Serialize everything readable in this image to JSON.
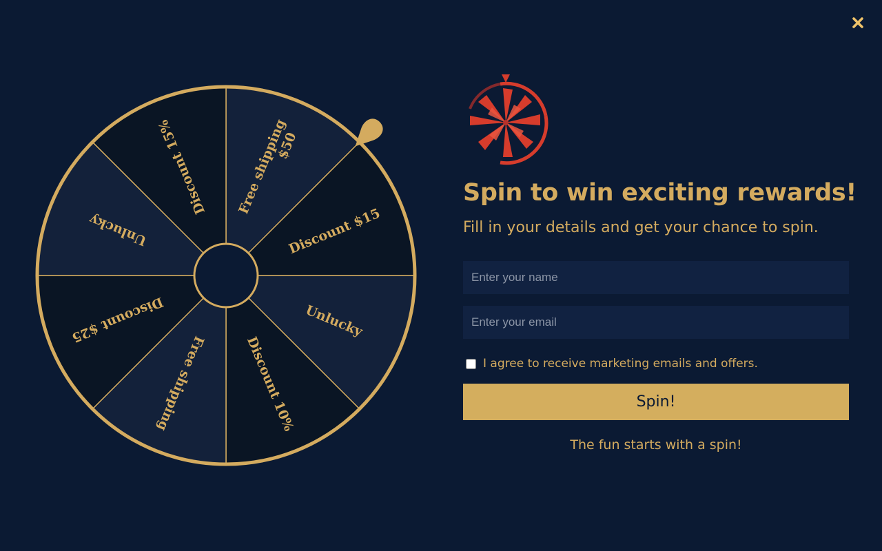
{
  "close": {
    "icon": "close-icon",
    "color": "#f0c36a"
  },
  "wheel": {
    "segments": [
      {
        "label": "Free shipping $50"
      },
      {
        "label": "Discount $15"
      },
      {
        "label": "Unlucky"
      },
      {
        "label": "Discount 10%"
      },
      {
        "label": "Free shipping"
      },
      {
        "label": "Discount $25"
      },
      {
        "label": "Unlucky"
      },
      {
        "label": "Discount 15%"
      }
    ],
    "colors": {
      "light": "#13213a",
      "dark": "#0a1524",
      "rim": "#d4ab5f",
      "hub": "#0b1a33"
    },
    "pointer_icon": "pointer-icon"
  },
  "panel": {
    "logo_icon": "spin-wheel-logo-icon",
    "logo_color": "#d63c2c",
    "title": "Spin to win exciting rewards!",
    "subtitle": "Fill in your details and get your chance to spin.",
    "name_placeholder": "Enter your name",
    "email_placeholder": "Enter your email",
    "agree_label": "I agree to receive marketing emails and offers.",
    "spin_label": "Spin!",
    "footer": "The fun starts with a spin!"
  }
}
